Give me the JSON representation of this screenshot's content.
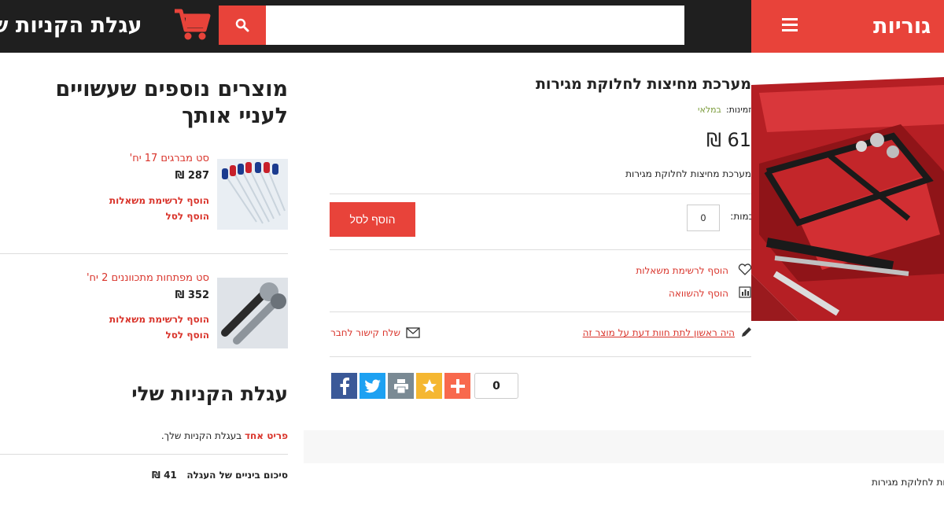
{
  "header": {
    "brand": "עגלת הקניות ש",
    "search_placeholder": "",
    "categories_label": "גוריות"
  },
  "sidebar": {
    "related_heading": "מוצרים נוספים שעשויים לעניי אותך",
    "products": [
      {
        "name": "סט מברגים 17 יח'",
        "price": "287",
        "currency": "₪",
        "wishlist": "הוסף לרשימת משאלות",
        "add_to_cart": "הוסף לסל"
      },
      {
        "name": "סט מפתחות מתכווננים 2 יח'",
        "price": "352",
        "currency": "₪",
        "wishlist": "הוסף לרשימת משאלות",
        "add_to_cart": "הוסף לסל"
      }
    ],
    "cart_heading": "עגלת הקניות שלי",
    "cart_items_link": "פריט אחד",
    "cart_items_text": "בעגלת הקניות שלך.",
    "subtotal_label": "סיכום ביניים של העגלה",
    "subtotal_value": "41",
    "currency": "₪"
  },
  "product": {
    "title": "מערכת מחיצות לחלוקת מגירות",
    "availability_label": "זמינות:",
    "availability_value": "במלאי",
    "price": "61",
    "currency": "₪",
    "short_description": "מערכת מחיצות לחלוקת מגירות",
    "qty_label": "כמות:",
    "qty_value": "0",
    "add_to_cart": "הוסף לסל",
    "wishlist": "הוסף לרשימת משאלות",
    "compare": "הוסף להשוואה",
    "review_link": "היה ראשון לתת חוות דעת על מוצר זה",
    "email_friend": "שלח קישור לחבר",
    "share_count": "0",
    "footer_label": "ות לחלוקת מגירות"
  },
  "colors": {
    "accent": "#e8433a",
    "header_bg": "#1f1f1f",
    "in_stock": "#7a9b3a",
    "facebook": "#3b5998",
    "twitter": "#1da1f2",
    "print": "#7a8a94",
    "favorite": "#f5b731",
    "addthis": "#f8694d"
  }
}
